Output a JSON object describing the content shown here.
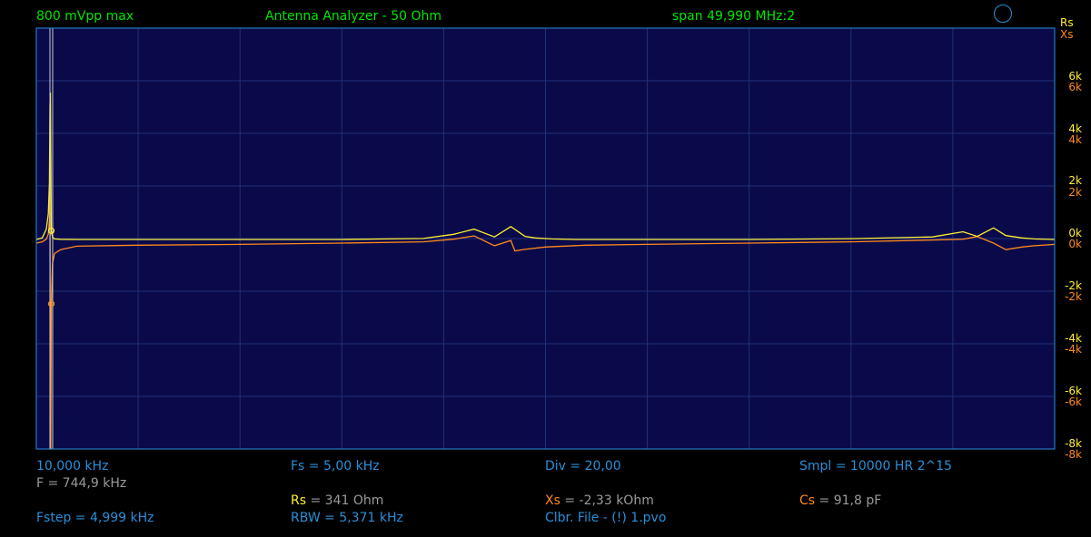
{
  "header": {
    "amplitude": "800 mVpp max",
    "mode": "Antenna Analyzer - 50 Ohm",
    "span": "span 49,990 MHz:2"
  },
  "axis": {
    "right_label_rs": "Rs",
    "right_label_xs": "Xs",
    "rs_ticks": [
      "6k",
      "4k",
      "2k",
      "0k",
      "-2k",
      "-4k",
      "-6k",
      "-8k"
    ],
    "xs_ticks": [
      "6k",
      "4k",
      "2k",
      "0k",
      "-2k",
      "-4k",
      "-6k",
      "-8k"
    ]
  },
  "footer": {
    "start_freq": "10,000 kHz",
    "marker_freq": "F = 744,9 kHz",
    "fs": "Fs = 5,00 kHz",
    "div": "Div = 20,00",
    "smpl": "Smpl = 10000 HR  2^15",
    "rs_label": "Rs",
    "rs_value": " = 341 Ohm",
    "xs_label": "Xs",
    "xs_value": " = -2,33 kOhm",
    "cs_label": "Cs",
    "cs_value": " = 91,8 pF",
    "fstep": "Fstep = 4,999 kHz",
    "rbw": "RBW = 5,371 kHz",
    "clbr": "Clbr. File - (!) 1.pvo"
  },
  "colors": {
    "background": "#000000",
    "plot_bg": "#0a0a4a",
    "grid": "#20307a",
    "border": "#2a8fd8",
    "rs_trace": "#ffee33",
    "xs_trace": "#ff8a1c",
    "header_text": "#00e600",
    "footer_text": "#2a8fd8"
  },
  "chart_data": {
    "type": "line",
    "x_unit": "MHz",
    "xlim": [
      0.01,
      50.0
    ],
    "rs_ylim": [
      -8000,
      8000
    ],
    "xs_ylim": [
      -8000,
      8000
    ],
    "marker_x": 0.745,
    "series": [
      {
        "name": "Rs",
        "x": [
          0.01,
          0.3,
          0.5,
          0.6,
          0.65,
          0.68,
          0.7,
          0.72,
          0.745,
          0.8,
          0.9,
          1.2,
          2,
          5,
          10,
          15,
          19,
          20.5,
          21.5,
          22.5,
          23.3,
          24.0,
          24.5,
          25.3,
          26.5,
          30,
          35,
          40,
          44,
          45.5,
          46.2,
          47.0,
          47.6,
          48.4,
          49.0,
          50.0
        ],
        "values": [
          0,
          60,
          400,
          1000,
          2200,
          5200,
          5700,
          3500,
          341,
          100,
          20,
          8,
          0,
          0,
          0,
          0,
          40,
          200,
          400,
          100,
          500,
          120,
          60,
          20,
          0,
          0,
          0,
          30,
          100,
          300,
          120,
          450,
          150,
          60,
          20,
          0
        ]
      },
      {
        "name": "Xs",
        "x": [
          0.01,
          0.3,
          0.5,
          0.6,
          0.65,
          0.68,
          0.7,
          0.72,
          0.745,
          0.8,
          0.9,
          1.2,
          2,
          5,
          10,
          15,
          19,
          20.5,
          21.5,
          22.5,
          23.3,
          23.5,
          24.0,
          25.0,
          27,
          30,
          35,
          40,
          44,
          45.5,
          46.2,
          47.0,
          47.6,
          48.4,
          49.0,
          50.0
        ],
        "values": [
          0,
          50,
          150,
          350,
          900,
          2000,
          -8000,
          -8000,
          -2330,
          -800,
          -400,
          -250,
          -120,
          -80,
          -50,
          0,
          50,
          150,
          280,
          -100,
          100,
          -300,
          -240,
          -150,
          -80,
          -50,
          0,
          50,
          120,
          150,
          250,
          0,
          -250,
          -150,
          -100,
          -50
        ]
      }
    ]
  }
}
